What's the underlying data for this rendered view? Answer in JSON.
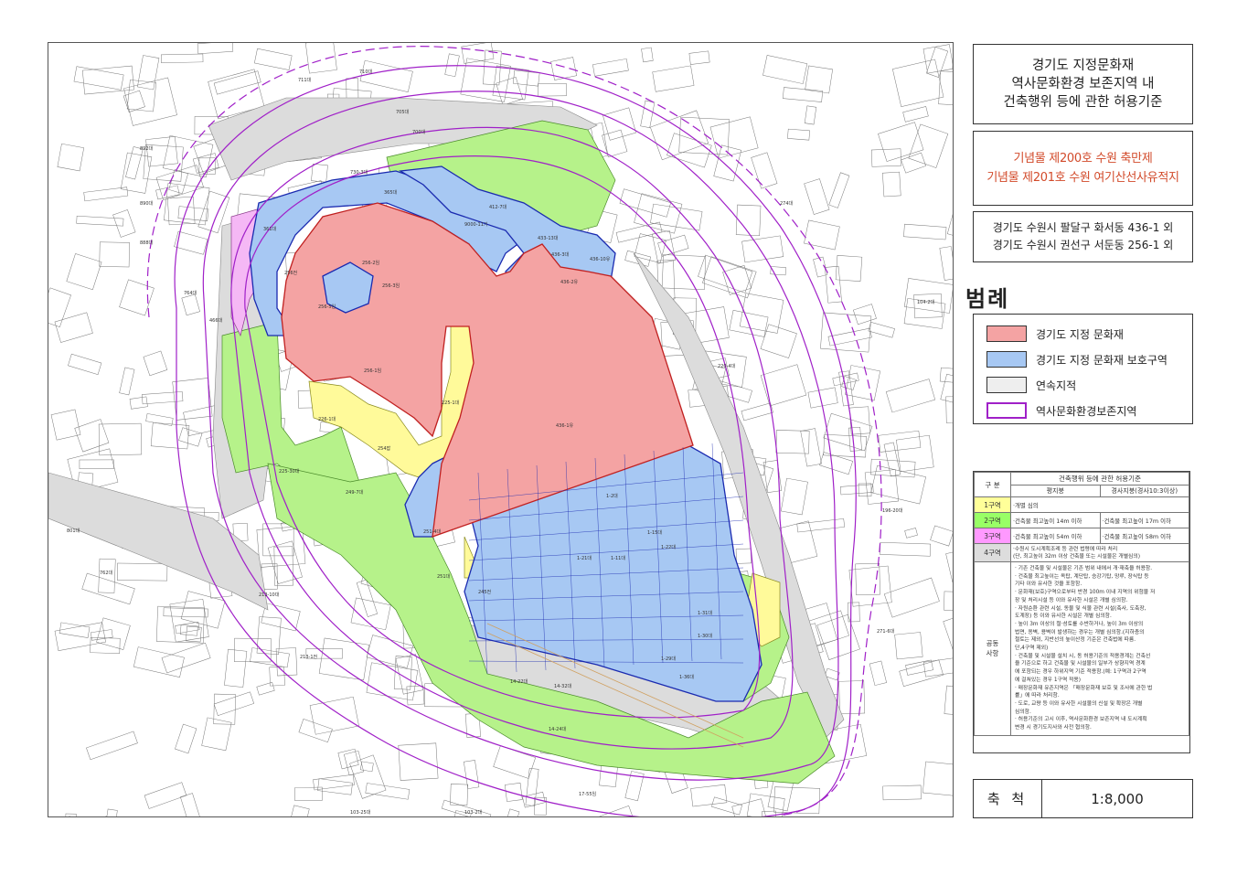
{
  "title": {
    "lines": [
      "경기도 지정문화재",
      "역사문화환경 보존지역 내",
      "건축행위 등에 관한 허용기준"
    ]
  },
  "assets": {
    "lines": [
      "기념물 제200호 수원 축만제",
      "기념물 제201호 수원 여기산선사유적지"
    ]
  },
  "address": {
    "lines": [
      "경기도 수원시 팔달구 화서동 436-1 외",
      "경기도 수원시 권선구 서둔동 256-1 외"
    ]
  },
  "legend": {
    "heading": "범례",
    "items": [
      {
        "label": "경기도 지정 문화재",
        "color": "#f4a3a3"
      },
      {
        "label": "경기도 지정 문화재 보호구역",
        "color": "#a7c8f3"
      },
      {
        "label": "연속지적",
        "color": "#eeeeee"
      },
      {
        "label": "역사문화환경보존지역",
        "color": "#ffffff",
        "border": "#a020c8"
      }
    ]
  },
  "criteria": {
    "col_group": "구 분",
    "col_header": "건축행위 등에 관한 허용기준",
    "sub_flat": "평지붕",
    "sub_slope": "경사지붕(경사10:3이상)",
    "zones": [
      {
        "name": "1구역",
        "color": "#ffff99",
        "flat": "·개별 심의",
        "slope": ""
      },
      {
        "name": "2구역",
        "color": "#99ff66",
        "flat": "·건축물 최고높이 14m 이하",
        "slope": "·건축물 최고높이 17m 이하"
      },
      {
        "name": "3구역",
        "color": "#ff99ff",
        "flat": "·건축물 최고높이 54m 이하",
        "slope": "·건축물 최고높이 58m 이하"
      },
      {
        "name": "4구역",
        "color": "#dddddd",
        "flat": "·수원시 도시계획조례 등 관련 법령에 따라 처리",
        "slope": "(단, 최고높이 32m 이상 건축물 또는 시설물은 개별심의)"
      }
    ],
    "common_label_1": "공동",
    "common_label_2": "사항",
    "common_notes": [
      "· 기존 건축물 및 시설물은 기존 범위 내에서 개·재축을 허용함.",
      "· 건축물 최고높이는 옥탑, 계단탑, 승강기탑, 망루, 장식탑 등",
      "  기타 이와 유사한 것을 포함함.",
      "· 문화재(보호)구역으로부터 반경 100m 이내 지역의 위험물 저",
      "  장 및 처리시설 등 이와 유사한 시설은 개별 심의함.",
      "· 자원순환 관련 시설, 동물 및 식물 관련 시설(축사, 도축장,",
      "  도계장) 등 이와 유사한 시설은 개별 심의함.",
      "· 높이 3m 이상의 절·성토를 수반하거나, 높이 3m 이상의",
      "  법면, 옹벽, 용벽이 발생하는 경우는 개별 심의함.(지하층의",
      "  절토는 제외, 지반선의 높이산정 기준은 건축법에 따름.",
      "  단,4구역 제외)",
      "· 건축물 및 시설물 설치 시, 동 허용기준의 적용경계는 건축선",
      "  을 기준으로 하고 건축물 및 시설물의 일부가 상향지역 경계",
      "  에 포함되는 경우 하위지역 기준 적용함.(예: 1구역과 2구역",
      "  에 걸쳐있는 경우 1구역 적용)",
      "· 매장문화재 유존지역은 「매장문화재 보호 및 조사에 관한 법",
      "  률」에 따라 처리함.",
      "· 도로, 교량 등 이와 유사한 시설물의 신설 및 확장은 개별",
      "  심의함.",
      "· 허용기준의 고시 이후, 역사문화환경 보존지역 내 도시계획",
      "  변경 시 경기도지사와 사전 협의함."
    ]
  },
  "scale": {
    "label": "축 척",
    "value": "1:8,000"
  },
  "map": {
    "parcel_labels": [
      "256-1임",
      "436-1유",
      "256-2임",
      "256-3임",
      "256-5임",
      "256전",
      "361대",
      "225-1대",
      "254잡",
      "436-3대",
      "436-10유",
      "436-2유",
      "433-13대",
      "412-7대",
      "9000-11기",
      "730-3대",
      "365대",
      "1-2대",
      "1-15대",
      "1-11대",
      "1-22대",
      "1-21대",
      "1-31대",
      "1-30대",
      "1-29대",
      "1-36대",
      "251-4대",
      "251대",
      "245전",
      "249-7대",
      "225-30대",
      "226-1대",
      "14-22대",
      "14-32대",
      "14-24대",
      "17-55임",
      "103-2대",
      "103-25대",
      "213-1전",
      "213-10대",
      "762대",
      "220-4대",
      "274대",
      "764대",
      "801대",
      "892대",
      "890대",
      "888대",
      "700대",
      "705대",
      "711대",
      "710대",
      "466대",
      "861대",
      "860대",
      "104-2대",
      "196-20대",
      "271-6대"
    ]
  }
}
